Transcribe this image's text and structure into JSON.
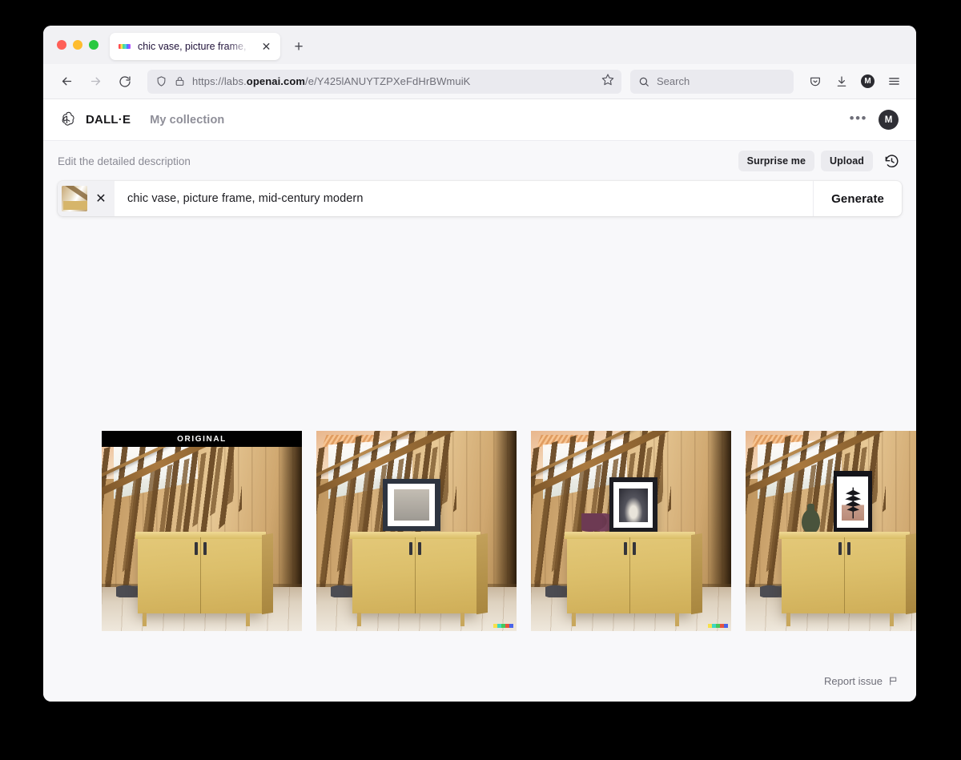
{
  "browser": {
    "traffic_lights": [
      "close",
      "minimize",
      "maximize"
    ],
    "tab": {
      "title": "chic vase, picture frame, mid-ce",
      "favicon": "dalle-rainbow-icon",
      "close_label": "✕"
    },
    "new_tab_label": "+",
    "back_label": "←",
    "forward_label": "→",
    "reload_label": "⟳",
    "url": {
      "prefix": "https://labs.",
      "domain": "openai.com",
      "path": "/e/Y425lANUYTZPXeFdHrBWmuiK"
    },
    "search": {
      "placeholder": "Search"
    }
  },
  "app": {
    "brand": "DALL·E",
    "nav": {
      "my_collection": "My collection"
    },
    "more_menu": "•••",
    "avatar_initial": "M"
  },
  "prompt": {
    "label": "Edit the detailed description",
    "surprise_me": "Surprise me",
    "upload": "Upload",
    "history_icon": "history-icon",
    "thumbnail_remove": "✕",
    "text": "chic vase, picture frame, mid-century modern",
    "generate": "Generate"
  },
  "results": {
    "original_badge": "ORIGINAL",
    "watermark_colors": [
      "#f7e04a",
      "#3fd7c4",
      "#46c85a",
      "#e8543d",
      "#4a63e8"
    ],
    "tiles": [
      {
        "kind": "original",
        "badge": "ORIGINAL",
        "description": "Original photo of a mustard yellow cabinet under a wooden staircase",
        "watermark": false,
        "decor": "none"
      },
      {
        "kind": "generated",
        "description": "Cabinet with a wide dark-framed landscape picture leaning on top",
        "watermark": true,
        "decor": "wide-frame"
      },
      {
        "kind": "generated",
        "description": "Cabinet with a black-framed abstract print and purple heeled shoes on top",
        "watermark": true,
        "decor": "frame-and-heels"
      },
      {
        "kind": "generated",
        "description": "Cabinet with a dark green round vase and a black-framed botanical leaf print",
        "watermark": true,
        "decor": "vase-and-leaf"
      }
    ]
  },
  "footer": {
    "report_issue": "Report issue",
    "report_icon": "flag-icon"
  }
}
